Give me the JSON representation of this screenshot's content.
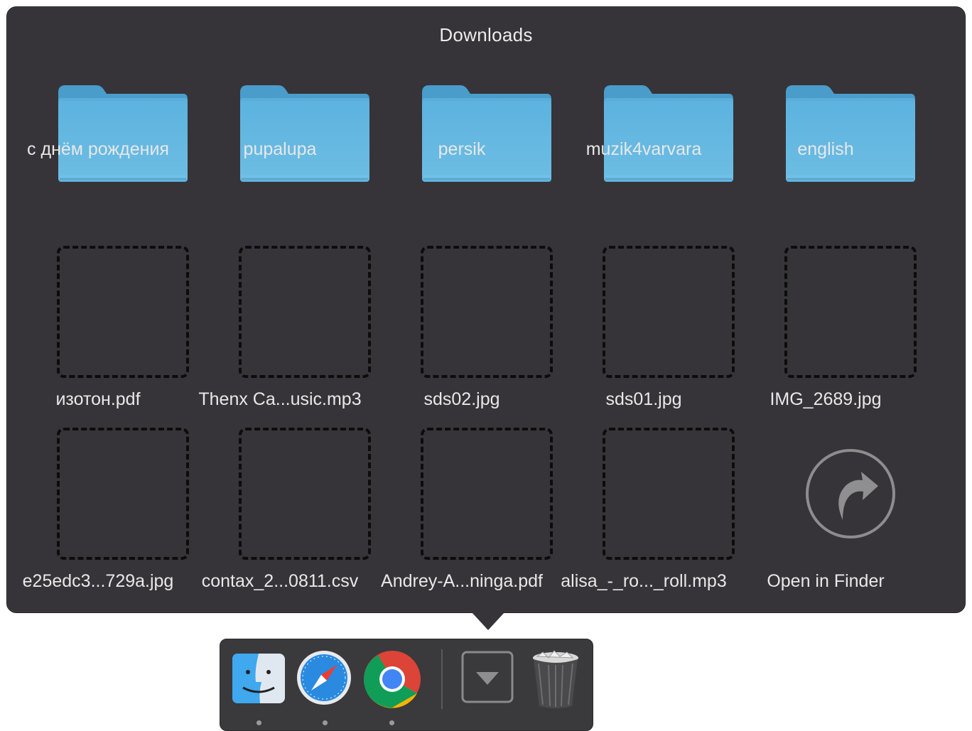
{
  "stack": {
    "title": "Downloads",
    "items": [
      {
        "label": "с днём рождения",
        "kind": "folder"
      },
      {
        "label": "pupalupa",
        "kind": "folder"
      },
      {
        "label": "persik",
        "kind": "folder"
      },
      {
        "label": "muzik4varvara",
        "kind": "folder"
      },
      {
        "label": "english",
        "kind": "folder"
      },
      {
        "label": "изотон.pdf",
        "kind": "file"
      },
      {
        "label": "Thenx Ca...usic.mp3",
        "kind": "file"
      },
      {
        "label": "sds02.jpg",
        "kind": "file"
      },
      {
        "label": "sds01.jpg",
        "kind": "file"
      },
      {
        "label": "IMG_2689.jpg",
        "kind": "file"
      },
      {
        "label": "e25edc3...729a.jpg",
        "kind": "file"
      },
      {
        "label": "contax_2...0811.csv",
        "kind": "file"
      },
      {
        "label": "Andrey-A...ninga.pdf",
        "kind": "file"
      },
      {
        "label": "alisa_-_ro..._roll.mp3",
        "kind": "file"
      },
      {
        "label": "Open in Finder",
        "kind": "action",
        "icon": "open-in-finder-icon"
      }
    ]
  },
  "dock": {
    "apps": [
      {
        "name": "finder-icon",
        "running": true
      },
      {
        "name": "safari-icon",
        "running": true
      },
      {
        "name": "chrome-icon",
        "running": true
      },
      {
        "name": "downloads-stack-icon",
        "running": false
      },
      {
        "name": "trash-icon",
        "running": false
      }
    ]
  },
  "colors": {
    "popover_bg": "#363438",
    "folder_blue": "#5fb4dd",
    "text": "#e8e8e8"
  }
}
